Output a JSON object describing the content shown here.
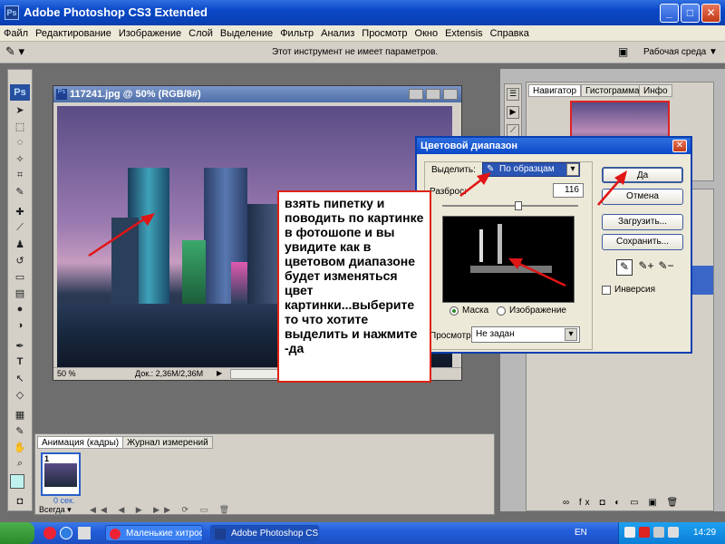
{
  "app": {
    "title": "Adobe Photoshop CS3 Extended",
    "logo": "Ps"
  },
  "menu": [
    "Файл",
    "Редактирование",
    "Изображение",
    "Слой",
    "Выделение",
    "Фильтр",
    "Анализ",
    "Просмотр",
    "Окно",
    "Extensis",
    "Справка"
  ],
  "options_bar": {
    "message": "Этот инструмент не имеет параметров.",
    "workspace": "Рабочая среда"
  },
  "document": {
    "title": "117241.jpg @ 50% (RGB/8#)",
    "zoom": "50 %",
    "doc_info": "Док.: 2,36M/2,36M"
  },
  "panels": {
    "tabs": [
      "Навигатор",
      "Гистограмма",
      "Инфо"
    ]
  },
  "animation_panel": {
    "tabs": [
      "Анимация (кадры)",
      "Журнал измерений"
    ],
    "frame_number": "1",
    "frame_time": "0 сек.",
    "loop": "Всегда"
  },
  "dialog": {
    "title": "Цветовой диапазон",
    "select_label": "Выделить:",
    "select_value": "По образцам",
    "fuzziness_label": "Разброс:",
    "fuzziness_value": "116",
    "buttons": {
      "ok": "Да",
      "cancel": "Отмена",
      "load": "Загрузить...",
      "save": "Сохранить..."
    },
    "invert_label": "Инверсия",
    "radio_mask": "Маска",
    "radio_image": "Изображение",
    "preview_label": "Просмотр:",
    "preview_value": "Не задан"
  },
  "callout": {
    "text": "взять пипетку и поводить по картинке в фотошопе и вы увидите как в цветовом диапазоне будет изменяться цвет картинки...выберите то что хотите выделить и нажмите -да"
  },
  "taskbar": {
    "tasks": [
      "Маленькие хитрост...",
      "Adobe Photoshop CS..."
    ],
    "language": "EN",
    "clock": "14:29"
  }
}
